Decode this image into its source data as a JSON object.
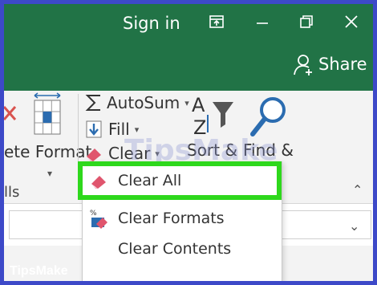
{
  "titlebar": {
    "signin_label": "Sign in",
    "share_label": "Share",
    "bg_color": "#217346"
  },
  "ribbon": {
    "delete_label_partial": "ete",
    "format_label": "Format",
    "group_label_partial": "lls",
    "autosum_label": "AutoSum",
    "fill_label": "Fill",
    "clear_label": "Clear",
    "sort_label": "Sort &",
    "find_label": "Find &"
  },
  "dropdown": {
    "items": [
      {
        "label": "Clear All",
        "icon": "eraser-icon",
        "highlighted": true
      },
      {
        "label": "Clear Formats",
        "icon": "clear-formats-icon"
      },
      {
        "label": "Clear Contents",
        "icon": ""
      }
    ]
  },
  "watermark": "TipsMake",
  "brand": "TipsMake",
  "colors": {
    "frame_border": "#3d49c8",
    "highlight_border": "#2ed81c",
    "eraser_pink": "#e0556d"
  }
}
